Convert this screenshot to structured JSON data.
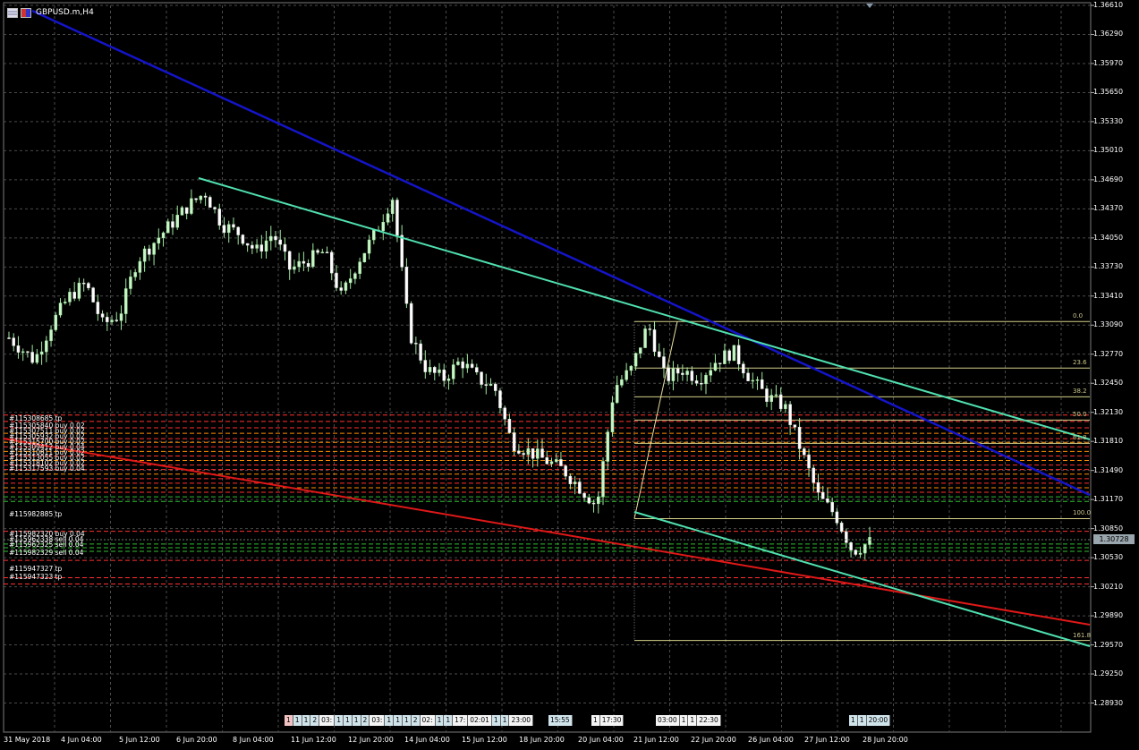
{
  "window": {
    "symbol_title": "GBPUSD.m,H4",
    "icons": [
      "chart-window-icon",
      "symbol-flag-icon"
    ]
  },
  "price_axis": {
    "ticks": [
      "1.36610",
      "1.36290",
      "1.35970",
      "1.35650",
      "1.35330",
      "1.35010",
      "1.34690",
      "1.34370",
      "1.34050",
      "1.33730",
      "1.33410",
      "1.33090",
      "1.32770",
      "1.32450",
      "1.32130",
      "1.31810",
      "1.31490",
      "1.31170",
      "1.30850",
      "1.30530",
      "1.30210",
      "1.29890",
      "1.29570",
      "1.29250",
      "1.28930"
    ],
    "current_price": "1.30728",
    "range": [
      1.2861,
      1.3661
    ]
  },
  "time_axis": {
    "ticks": [
      "31 May 2018",
      "4 Jun 04:00",
      "5 Jun 12:00",
      "6 Jun 20:00",
      "8 Jun 04:00",
      "11 Jun 12:00",
      "12 Jun 20:00",
      "14 Jun 04:00",
      "15 Jun 12:00",
      "18 Jun 20:00",
      "20 Jun 04:00",
      "21 Jun 12:00",
      "22 Jun 20:00",
      "26 Jun 04:00",
      "27 Jun 12:00",
      "28 Jun 20:00"
    ]
  },
  "fibonacci": {
    "high": 1.3313,
    "low": 1.3096,
    "levels": [
      {
        "label": "0.0",
        "ratio": 0
      },
      {
        "label": "23.6",
        "ratio": 0.236
      },
      {
        "label": "38.2",
        "ratio": 0.382
      },
      {
        "label": "50.0",
        "ratio": 0.5
      },
      {
        "label": "61.8",
        "ratio": 0.618
      },
      {
        "label": "100.0",
        "ratio": 1
      },
      {
        "label": "161.8",
        "ratio": 1.618
      }
    ]
  },
  "order_labels": [
    "#115308685 tp",
    "#115305840 buy 0.02",
    "#115307511 buy 0.02",
    "#115305932 buy 0.02",
    "#115315700 buy 0.02",
    "#115309412 buy 0.04",
    "#115310811 buy 0.02",
    "#115313055 buy 0.02",
    "#115318102 buy 0.02",
    "#115317593 buy 0.04",
    "#115982885 tp",
    "#115982320 buy 0.04",
    "#115962338 sell 0.04",
    "#115962325 sell 0.04",
    "#115982329 sell 0.04",
    "#115947327 tp",
    "#115947323 tp"
  ],
  "event_groups": [
    {
      "items": [
        {
          "t": "1",
          "c": "pink"
        },
        {
          "t": "1",
          "c": "blue"
        },
        {
          "t": "1",
          "c": "blue"
        },
        {
          "t": "2",
          "c": "blue"
        },
        {
          "t": "03:",
          "c": "white"
        },
        {
          "t": "1",
          "c": "blue"
        },
        {
          "t": "1",
          "c": "blue"
        },
        {
          "t": "1",
          "c": "blue"
        },
        {
          "t": "2",
          "c": "blue"
        },
        {
          "t": "03:",
          "c": "white"
        },
        {
          "t": "1",
          "c": "blue"
        },
        {
          "t": "1",
          "c": "blue"
        },
        {
          "t": "1",
          "c": "blue"
        },
        {
          "t": "2",
          "c": "blue"
        },
        {
          "t": "02:",
          "c": "white"
        },
        {
          "t": "1",
          "c": "blue"
        },
        {
          "t": "1",
          "c": "blue"
        },
        {
          "t": "17:",
          "c": "white"
        },
        {
          "t": "02:01",
          "c": "white"
        },
        {
          "t": "1",
          "c": "blue"
        },
        {
          "t": "1",
          "c": "blue"
        },
        {
          "t": "23:00",
          "c": "white"
        }
      ]
    },
    {
      "items": [
        {
          "t": "15:55",
          "c": "blue"
        }
      ]
    },
    {
      "items": [
        {
          "t": "1",
          "c": "white"
        },
        {
          "t": "17:30",
          "c": "white"
        }
      ]
    },
    {
      "items": [
        {
          "t": "03:00",
          "c": "white"
        },
        {
          "t": "1",
          "c": "white"
        },
        {
          "t": "1",
          "c": "white"
        },
        {
          "t": "22:30",
          "c": "white"
        }
      ]
    },
    {
      "items": [
        {
          "t": "1",
          "c": "blue"
        },
        {
          "t": "1",
          "c": "blue"
        },
        {
          "t": "20:00",
          "c": "blue"
        }
      ]
    }
  ],
  "colors": {
    "background": "#000000",
    "grid": "#4a4a4a",
    "bull_candle": "#c8f5c8",
    "bear_candle": "#ffffff",
    "wick": "#9fe89f",
    "trend_blue": "#1414c8",
    "trend_red": "#e01818",
    "channel_aqua": "#50e0b0",
    "fib_line": "#d4d08a",
    "order_red": "#ff3030",
    "order_orange": "#ff8c00",
    "order_green": "#30c030"
  },
  "chart_data": {
    "type": "candlestick",
    "symbol": "GBPUSD.m",
    "timeframe": "H4",
    "x": [
      "31 May 2018",
      "4 Jun 04:00",
      "5 Jun 12:00",
      "6 Jun 20:00",
      "8 Jun 04:00",
      "11 Jun 12:00",
      "12 Jun 20:00",
      "14 Jun 04:00",
      "15 Jun 12:00",
      "18 Jun 20:00",
      "20 Jun 04:00",
      "21 Jun 12:00",
      "22 Jun 20:00",
      "26 Jun 04:00",
      "27 Jun 12:00",
      "28 Jun 20:00"
    ],
    "y_range": [
      1.2861,
      1.3661
    ],
    "grid": true,
    "approx_close_path": [
      [
        0,
        1.3295
      ],
      [
        6,
        1.327
      ],
      [
        10,
        1.331
      ],
      [
        14,
        1.334
      ],
      [
        18,
        1.3355
      ],
      [
        22,
        1.331
      ],
      [
        26,
        1.332
      ],
      [
        30,
        1.338
      ],
      [
        34,
        1.34
      ],
      [
        38,
        1.342
      ],
      [
        42,
        1.344
      ],
      [
        46,
        1.3455
      ],
      [
        50,
        1.342
      ],
      [
        54,
        1.341
      ],
      [
        58,
        1.339
      ],
      [
        62,
        1.341
      ],
      [
        66,
        1.337
      ],
      [
        70,
        1.338
      ],
      [
        74,
        1.339
      ],
      [
        78,
        1.334
      ],
      [
        82,
        1.338
      ],
      [
        86,
        1.341
      ],
      [
        90,
        1.345
      ],
      [
        94,
        1.33
      ],
      [
        98,
        1.326
      ],
      [
        102,
        1.325
      ],
      [
        106,
        1.327
      ],
      [
        110,
        1.325
      ],
      [
        114,
        1.324
      ],
      [
        118,
        1.318
      ],
      [
        122,
        1.317
      ],
      [
        126,
        1.316
      ],
      [
        130,
        1.315
      ],
      [
        134,
        1.313
      ],
      [
        138,
        1.311
      ],
      [
        142,
        1.324
      ],
      [
        146,
        1.326
      ],
      [
        150,
        1.331
      ],
      [
        154,
        1.325
      ],
      [
        158,
        1.326
      ],
      [
        162,
        1.325
      ],
      [
        166,
        1.327
      ],
      [
        170,
        1.328
      ],
      [
        174,
        1.325
      ],
      [
        178,
        1.323
      ],
      [
        182,
        1.322
      ],
      [
        186,
        1.317
      ],
      [
        190,
        1.312
      ],
      [
        194,
        1.31
      ],
      [
        198,
        1.306
      ],
      [
        202,
        1.307
      ]
    ]
  }
}
